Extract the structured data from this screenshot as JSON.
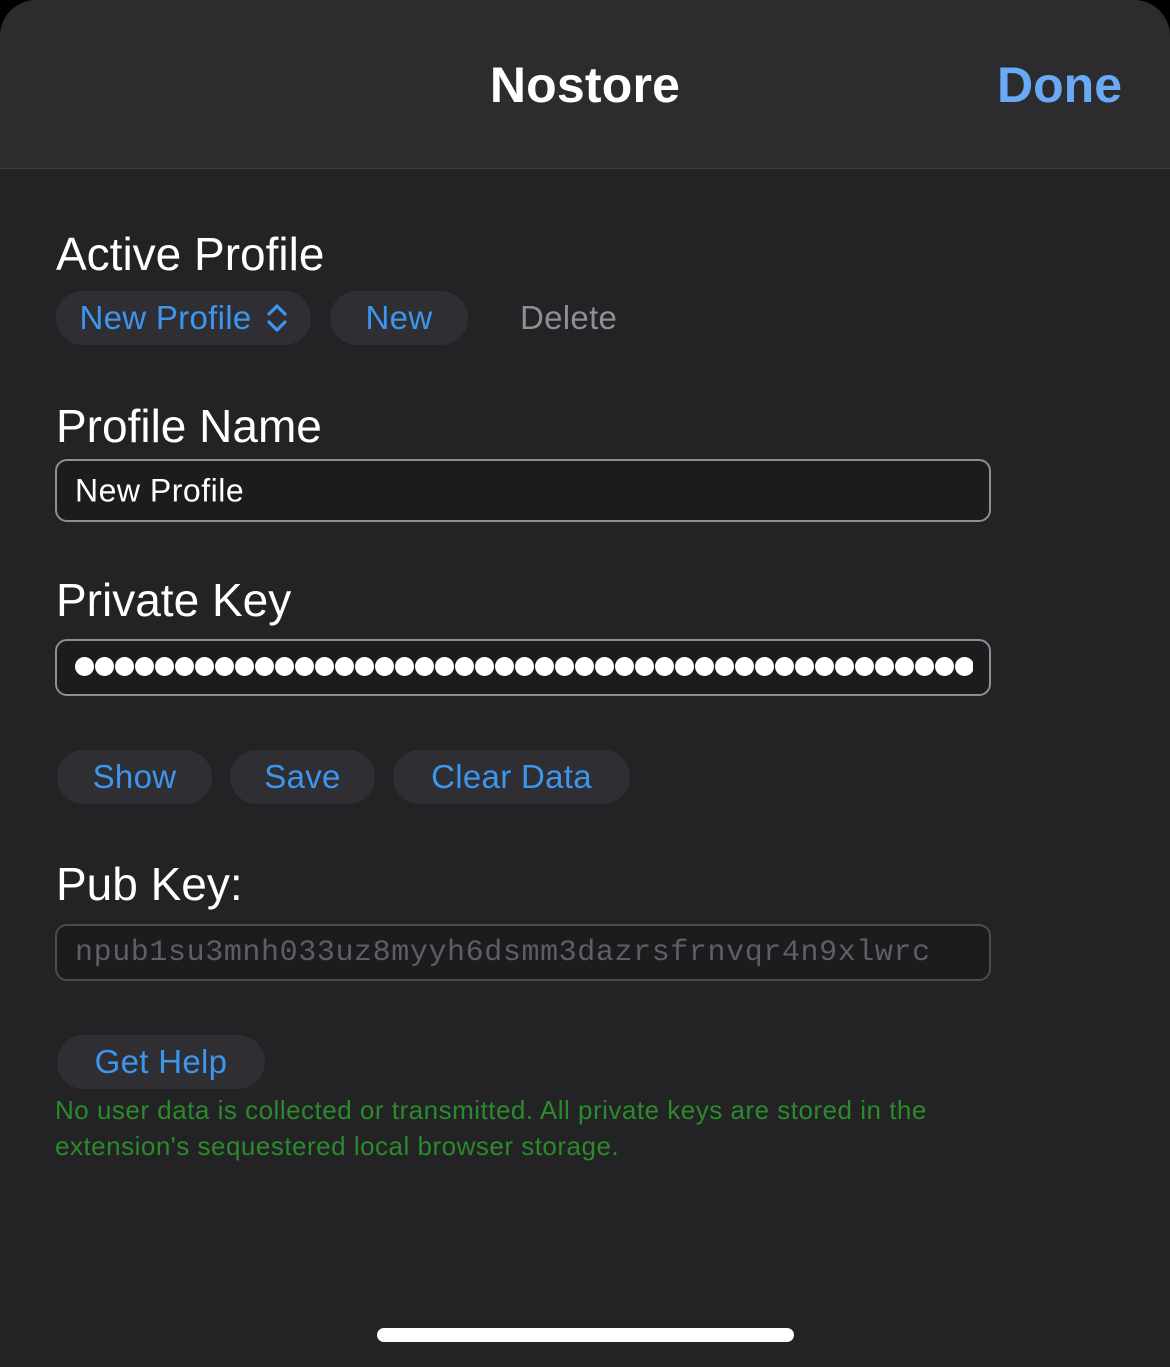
{
  "nav": {
    "title": "Nostore",
    "done_label": "Done"
  },
  "active_profile": {
    "heading": "Active Profile",
    "selected_profile": "New Profile",
    "new_label": "New",
    "delete_label": "Delete"
  },
  "profile_name": {
    "heading": "Profile Name",
    "value": "New Profile"
  },
  "private_key": {
    "heading": "Private Key",
    "masked": true
  },
  "key_actions": {
    "show_label": "Show",
    "save_label": "Save",
    "clear_label": "Clear Data"
  },
  "pub_key": {
    "heading": "Pub Key:",
    "value": "npub1su3mnh033uz8myyh6dsmm3dazrsfrnvqr4n9xlwrc"
  },
  "help": {
    "label": "Get Help",
    "note": "No user data is collected or transmitted. All private keys are stored in the extension's sequestered local browser storage."
  },
  "colors": {
    "accent": "#3d95ed",
    "done": "#6aa9f5",
    "note_green": "#2b8a2b",
    "background": "#232325"
  }
}
